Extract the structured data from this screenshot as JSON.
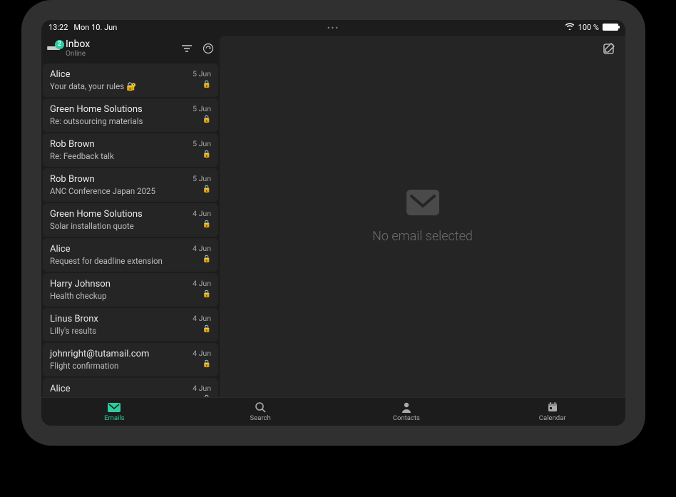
{
  "status": {
    "time": "13:22",
    "date": "Mon 10. Jun",
    "battery_pct": "100 %",
    "ellipsis": "•••"
  },
  "header": {
    "title": "Inbox",
    "status": "Online",
    "unread_badge": "2"
  },
  "emails": [
    {
      "sender": "Alice",
      "subject": "Your data, your rules 🔐",
      "date": "5 Jun",
      "locked": true
    },
    {
      "sender": "Green Home Solutions",
      "subject": "Re: outsourcing materials",
      "date": "5 Jun",
      "locked": true
    },
    {
      "sender": "Rob Brown",
      "subject": "Re: Feedback talk",
      "date": "5 Jun",
      "locked": true
    },
    {
      "sender": "Rob Brown",
      "subject": "ANC Conference Japan 2025",
      "date": "5 Jun",
      "locked": true
    },
    {
      "sender": "Green Home Solutions",
      "subject": "Solar installation quote",
      "date": "4 Jun",
      "locked": true
    },
    {
      "sender": "Alice",
      "subject": "Request for deadline extension",
      "date": "4 Jun",
      "locked": true
    },
    {
      "sender": "Harry Johnson",
      "subject": "Health checkup",
      "date": "4 Jun",
      "locked": true
    },
    {
      "sender": "Linus Bronx",
      "subject": "Lilly's results",
      "date": "4 Jun",
      "locked": true
    },
    {
      "sender": "johnright@tutamail.com",
      "subject": "Flight confirmation",
      "date": "4 Jun",
      "locked": true
    },
    {
      "sender": "Alice",
      "subject": "",
      "date": "4 Jun",
      "locked": true
    }
  ],
  "content": {
    "empty_text": "No email selected"
  },
  "nav": {
    "emails": "Emails",
    "search": "Search",
    "contacts": "Contacts",
    "calendar": "Calendar"
  },
  "colors": {
    "accent": "#2ecca0",
    "bg": "#1c1c1c",
    "panel": "#252525"
  }
}
